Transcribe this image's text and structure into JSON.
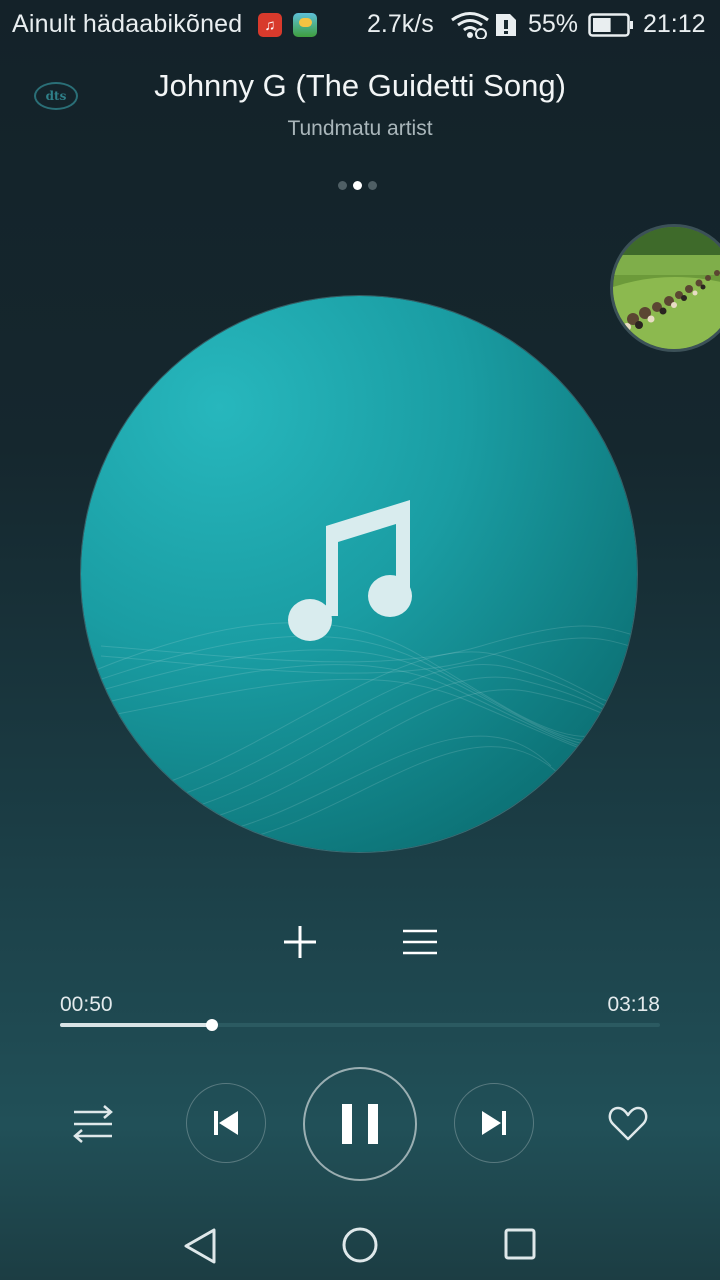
{
  "status_bar": {
    "carrier": "Ainult hädaabikõned",
    "notification_icons": [
      "music-notification-icon",
      "weather-notification-icon"
    ],
    "network_speed": "2.7k/s",
    "battery_percent": "55%",
    "battery_level": 0.55,
    "time": "21:12"
  },
  "header": {
    "audio_badge": "dts",
    "song_title": "Johnny G (The Guidetti Song)",
    "artist": "Tundmatu artist",
    "page_count": 3,
    "active_page": 1
  },
  "album": {
    "placeholder_icon": "music-note-icon",
    "colors": {
      "light": "#27b7bd",
      "dark": "#0a6467"
    }
  },
  "actions": {
    "add_icon": "plus-icon",
    "queue_icon": "list-icon"
  },
  "progress": {
    "current_time": "00:50",
    "total_time": "03:18",
    "fraction": 0.2525
  },
  "controls": {
    "shuffle_icon": "repeat-shuffle-icon",
    "prev_icon": "skip-previous-icon",
    "play_state_icon": "pause-icon",
    "next_icon": "skip-next-icon",
    "favorite_icon": "heart-icon"
  },
  "nav_bar": {
    "icons": [
      "back-triangle-icon",
      "home-circle-icon",
      "recents-square-icon"
    ]
  }
}
